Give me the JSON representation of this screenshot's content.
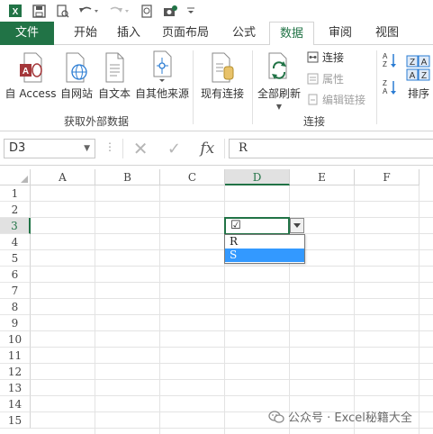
{
  "qat": {
    "icons": [
      "excel-logo-icon",
      "save-icon",
      "print-preview-icon",
      "undo-icon",
      "redo-icon",
      "preview-icon",
      "camera-icon",
      "customize-icon"
    ]
  },
  "tabs": [
    {
      "label": "文件"
    },
    {
      "label": "开始"
    },
    {
      "label": "插入"
    },
    {
      "label": "页面布局"
    },
    {
      "label": "公式"
    },
    {
      "label": "数据"
    },
    {
      "label": "审阅"
    },
    {
      "label": "视图"
    }
  ],
  "active_tab": "数据",
  "ribbon": {
    "get_external": {
      "access": "自 Access",
      "web": "自网站",
      "text": "自文本",
      "other": "自其他来源",
      "group_label": "获取外部数据"
    },
    "existing_connections": "现有连接",
    "refresh_all": "全部刷新",
    "connections": {
      "connect": "连接",
      "properties": "属性",
      "edit_links": "编辑链接",
      "group_label": "连接"
    },
    "sort": "排序"
  },
  "formula_bar": {
    "name_box": "D3",
    "dots": "⋮",
    "cancel": "✕",
    "enter": "✓",
    "fx": "fx",
    "value": "R"
  },
  "grid": {
    "columns": [
      "A",
      "B",
      "C",
      "D",
      "E",
      "F"
    ],
    "rows": [
      "1",
      "2",
      "3",
      "4",
      "5",
      "6",
      "7",
      "8",
      "9",
      "10",
      "11",
      "12",
      "13",
      "14",
      "15"
    ],
    "active_cell_symbol": "☑",
    "dropdown_options": [
      "R",
      "S"
    ],
    "highlighted_option": "S"
  },
  "watermark": "公众号 · Excel秘籍大全",
  "colors": {
    "accent": "#217346",
    "selection": "#3399ff",
    "access": "#a4373a",
    "web": "#2b7cd3"
  }
}
